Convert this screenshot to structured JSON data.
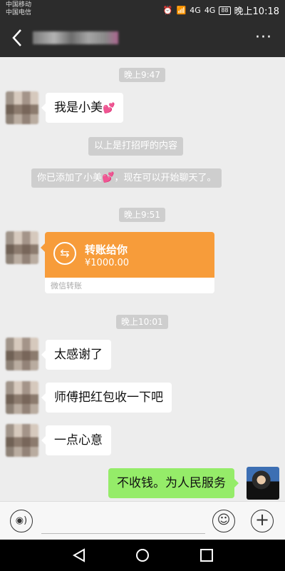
{
  "status_bar": {
    "carrier1": "中国移动",
    "carrier2": "中国电信",
    "signal_label": "4G",
    "signal_label2": "4G",
    "battery": "88",
    "time": "晚上10:18"
  },
  "navbar": {
    "more_label": "···"
  },
  "messages": {
    "time1": "晚上9:47",
    "msg1_text": "我是小美",
    "msg1_emoji": "💕",
    "sys1": "以上是打招呼的内容",
    "sys2_prefix": "你已添加了小美",
    "sys2_emoji": "💕",
    "sys2_suffix": "，现在可以开始聊天了。",
    "time2": "晚上9:51",
    "transfer": {
      "title": "转账给你",
      "amount": "¥1000.00",
      "footer": "微信转账",
      "icon": "⇆"
    },
    "time3": "晚上10:01",
    "msg2_text": "太感谢了",
    "msg3_text": "师傅把红包收一下吧",
    "msg4_text": "一点心意",
    "msg5_text": "不收钱。为人民服务"
  },
  "input_bar": {
    "voice_icon": "◉)",
    "emoji_icon": "☺",
    "plus_icon": "+"
  },
  "colors": {
    "navbar_bg": "#2c2c2c",
    "chat_bg": "#ededed",
    "self_bubble": "#95ec69",
    "transfer_orange": "#f79c3a"
  }
}
